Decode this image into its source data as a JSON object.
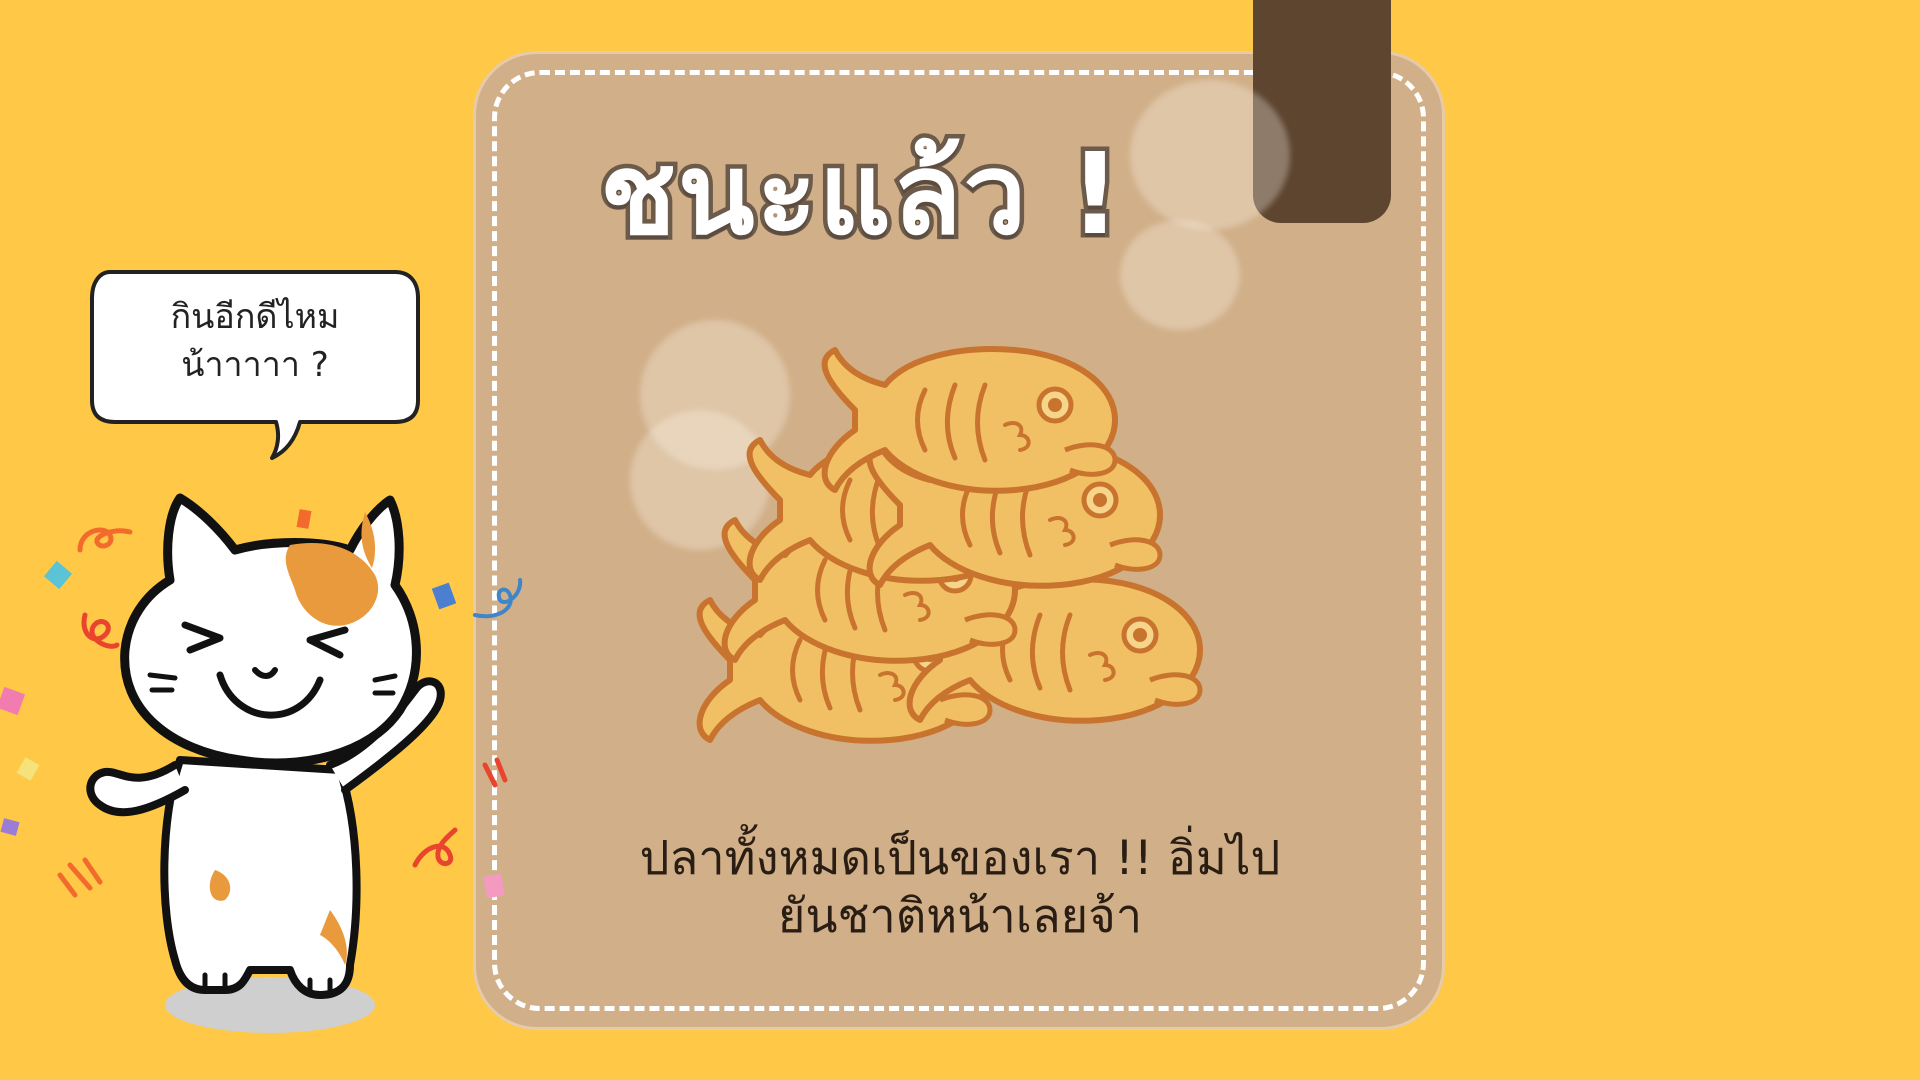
{
  "result": {
    "title": "ชนะแล้ว !",
    "caption_line1": "ปลาทั้งหมดเป็นของเรา !! อิ่มไป",
    "caption_line2": "ยันชาติหน้าเลยจ้า"
  },
  "speech_bubble": {
    "line1": "กินอีกดีไหม",
    "line2": "น้าาาาา ?"
  },
  "colors": {
    "background": "#FFC846",
    "card": "#D1B089",
    "tab": "#5D4530",
    "fish": "#F2C064",
    "fish_outline": "#C8742E"
  },
  "icons": {
    "mascot": "happy-cat-icon",
    "food": "taiyaki-fish-icon"
  }
}
